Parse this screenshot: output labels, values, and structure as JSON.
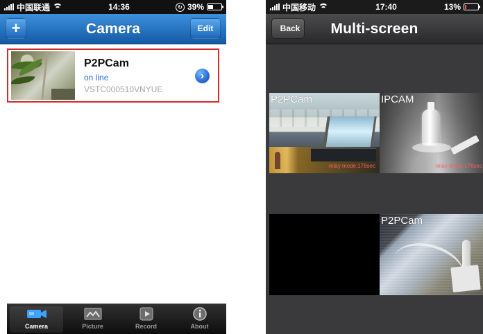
{
  "left_screen": {
    "status_bar": {
      "carrier": "中国联通",
      "time": "14:36",
      "battery": "39%"
    },
    "nav": {
      "add_label": "+",
      "title": "Camera",
      "edit_label": "Edit"
    },
    "camera_item": {
      "name": "P2PCam",
      "status": "on line",
      "id": "VSTC000510VNYUE"
    },
    "tabs": [
      {
        "label": "Camera",
        "icon": "camera-icon"
      },
      {
        "label": "Picture",
        "icon": "picture-icon"
      },
      {
        "label": "Record",
        "icon": "record-icon"
      },
      {
        "label": "About",
        "icon": "info-icon"
      }
    ]
  },
  "right_screen": {
    "status_bar": {
      "carrier": "中国移动",
      "time": "17:40",
      "battery": "13%"
    },
    "nav": {
      "back_label": "Back",
      "title": "Multi-screen"
    },
    "cells": [
      {
        "label": "P2PCam",
        "relay_text": "relay mode:178sec"
      },
      {
        "label": "IPCAM",
        "relay_text": "relay mode:178sec"
      },
      {
        "label": "",
        "relay_text": ""
      },
      {
        "label": "P2PCam",
        "relay_text": ""
      }
    ]
  },
  "colors": {
    "left_nav_blue": "#1d67b9",
    "selected_border": "#d72a2a",
    "status_blue": "#2e6fcf",
    "relay_red": "#ff5b5b",
    "right_bg": "#3a3a3c"
  },
  "icons": {
    "status": [
      "signal-icon",
      "wifi-icon",
      "lock-icon",
      "battery-icon"
    ],
    "disclosure": "chevron-right-icon"
  },
  "battery_levels": {
    "left": 0.39,
    "right": 0.13
  }
}
